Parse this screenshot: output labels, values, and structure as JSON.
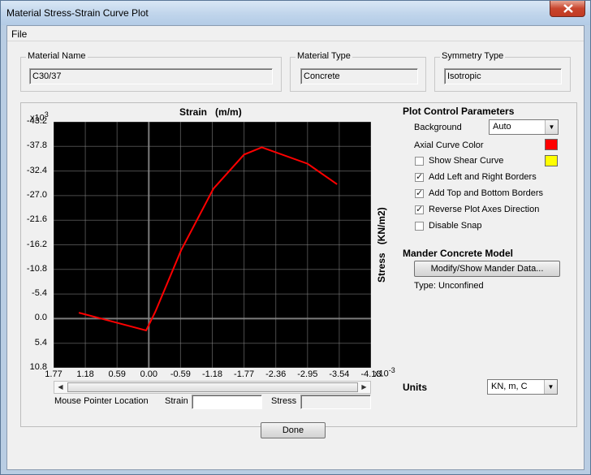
{
  "window": {
    "title": "Material Stress-Strain Curve Plot"
  },
  "menu": {
    "file": "File"
  },
  "material": {
    "name_label": "Material Name",
    "name_value": "C30/37",
    "type_label": "Material Type",
    "type_value": "Concrete",
    "symmetry_label": "Symmetry Type",
    "symmetry_value": "Isotropic"
  },
  "plot": {
    "x_title": "Strain",
    "x_units": "(m/m)",
    "y_title": "Stress",
    "y_units": "(KN/m2)",
    "y_multiplier_base": "x10",
    "y_multiplier_exp": "3",
    "x_multiplier_base": "x10",
    "x_multiplier_exp": "-3",
    "curve_color": "#ff0000",
    "background_color": "#000000",
    "grid_color": "#888888"
  },
  "chart_data": {
    "type": "line",
    "title": "",
    "xlabel": "Strain (m/m)",
    "ylabel": "Stress (KN/m2)",
    "x_ticks": [
      "1.77",
      "1.18",
      "0.59",
      "0.00",
      "-0.59",
      "-1.18",
      "-1.77",
      "-2.36",
      "-2.95",
      "-3.54",
      "-4.13"
    ],
    "y_ticks": [
      "-43.2",
      "-37.8",
      "-32.4",
      "-27.0",
      "-21.6",
      "-16.2",
      "-10.8",
      "-5.4",
      "0.0",
      "5.4",
      "10.8"
    ],
    "xlim": [
      1.77,
      -4.13
    ],
    "ylim": [
      -43.2,
      10.8
    ],
    "x_scale_note": "values x10^-3",
    "y_scale_note": "values x10^3",
    "reversed_axes": true,
    "grid": true,
    "series": [
      {
        "values_x": [
          1.3,
          0.05,
          -0.12,
          -0.6,
          -1.2,
          -1.77,
          -2.1,
          -2.95,
          -3.5
        ],
        "values_y": [
          -1.3,
          2.6,
          -1.5,
          -15.0,
          -28.5,
          -36.0,
          -37.6,
          -34.0,
          -29.5
        ]
      }
    ]
  },
  "mouse": {
    "label": "Mouse Pointer Location",
    "strain_label": "Strain",
    "stress_label": "Stress",
    "strain_value": "",
    "stress_value": ""
  },
  "controls": {
    "heading": "Plot Control Parameters",
    "background_label": "Background",
    "background_value": "Auto",
    "axial_color_label": "Axial Curve Color",
    "axial_color": "#ff0000",
    "shear_color": "#ffff00",
    "show_shear_label": "Show Shear Curve",
    "show_shear_checked": false,
    "lr_borders_label": "Add Left and Right Borders",
    "lr_borders_checked": true,
    "tb_borders_label": "Add Top and Bottom Borders",
    "tb_borders_checked": true,
    "reverse_label": "Reverse Plot Axes Direction",
    "reverse_checked": true,
    "snap_label": "Disable Snap",
    "snap_checked": false
  },
  "mander": {
    "heading": "Mander Concrete Model",
    "button": "Modify/Show Mander Data...",
    "type_text": "Type:  Unconfined"
  },
  "units": {
    "label": "Units",
    "value": "KN, m, C"
  },
  "done": "Done"
}
